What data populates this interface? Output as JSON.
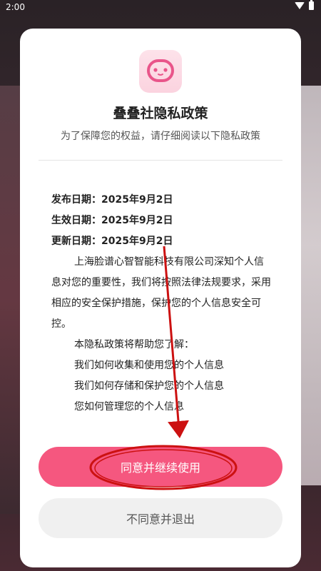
{
  "status_bar": {
    "time": "2:00",
    "icons": [
      "wifi-icon",
      "battery-icon"
    ]
  },
  "dialog": {
    "app_icon": "app-logo-icon",
    "title": "叠叠社隐私政策",
    "subtitle": "为了保障您的权益，请仔细阅读以下隐私政策",
    "dates": [
      "发布日期：2025年9月2日",
      "生效日期：2025年9月2日",
      "更新日期：2025年9月2日"
    ],
    "paragraph": "上海脸谱心智智能科技有限公司深知个人信息对您的重要性，我们将按照法律法规要求，采用相应的安全保护措施，保护您的个人信息安全可控。",
    "intro": "本隐私政策将帮助您了解：",
    "items": [
      "我们如何收集和使用您的个人信息",
      "我们如何存储和保护您的个人信息",
      "您如何管理您的个人信息"
    ],
    "agree_label": "同意并继续使用",
    "disagree_label": "不同意并退出"
  },
  "colors": {
    "accent": "#f5577f",
    "annotation": "#cc1111",
    "secondary_button": "#f0f0f0"
  }
}
